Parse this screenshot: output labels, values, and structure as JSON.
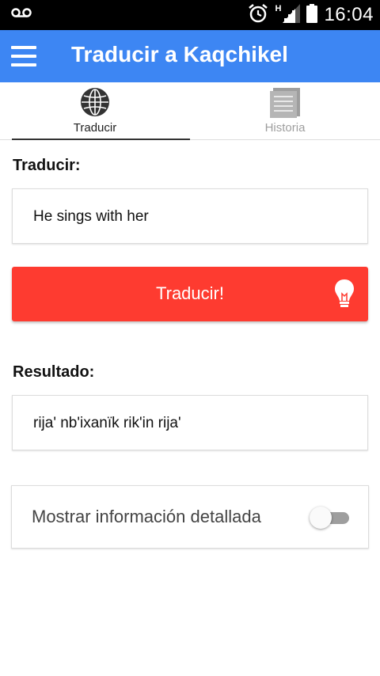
{
  "status_bar": {
    "network_label": "H",
    "time": "16:04",
    "icons": [
      "voicemail-icon",
      "alarm-icon",
      "signal-icon",
      "battery-icon"
    ]
  },
  "app_bar": {
    "title": "Traducir a Kaqchikel",
    "menu_icon": "hamburger-menu-icon",
    "color": "#3d86f3"
  },
  "tabs": [
    {
      "label": "Traducir",
      "icon": "globe-icon",
      "selected": true
    },
    {
      "label": "Historia",
      "icon": "document-icon",
      "selected": false
    }
  ],
  "input": {
    "label": "Traducir:",
    "value": "He sings with her"
  },
  "translate_button": {
    "label": "Traducir!",
    "icon": "lightbulb-icon",
    "color": "#fe3b30"
  },
  "result": {
    "label": "Resultado:",
    "value": "rija' nb'ixanïk rik'in rija'"
  },
  "details_toggle": {
    "label": "Mostrar información detallada",
    "checked": false
  }
}
